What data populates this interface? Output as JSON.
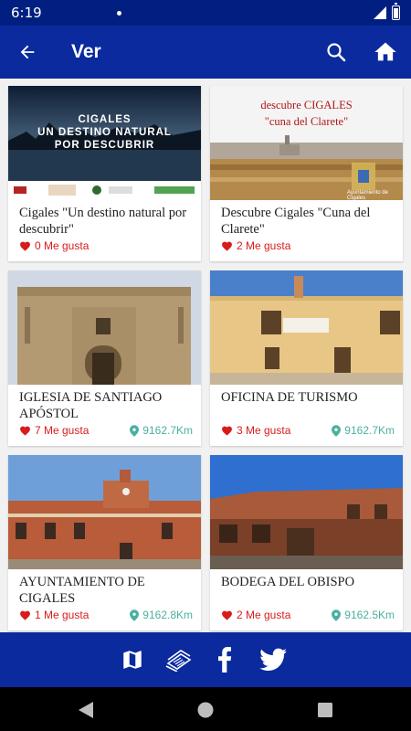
{
  "status": {
    "time": "6:19"
  },
  "app_bar": {
    "title": "Ver"
  },
  "cards": [
    {
      "name": "Cigales \"Un destino natural por descubrir\"",
      "likes": "0 Me gusta",
      "distance": "",
      "image_text": "CIGALES\nUN DESTINO NATURAL\nPOR DESCUBRIR"
    },
    {
      "name": "Descubre Cigales \"Cuna del Clarete\"",
      "likes": "2 Me gusta",
      "distance": "",
      "image_text_1": "descubre CIGALES",
      "image_text_2": "\"cuna del Clarete\"",
      "image_caption": "Ayuntamiento de Cigales"
    },
    {
      "name": "IGLESIA DE SANTIAGO APÓSTOL",
      "likes": "7 Me gusta",
      "distance": "9162.7Km"
    },
    {
      "name": "OFICINA DE TURISMO",
      "likes": "3 Me gusta",
      "distance": "9162.7Km"
    },
    {
      "name": "AYUNTAMIENTO DE CIGALES",
      "likes": "1 Me gusta",
      "distance": "9162.8Km"
    },
    {
      "name": "BODEGA DEL OBISPO",
      "likes": "2 Me gusta",
      "distance": "9162.5Km"
    }
  ],
  "colors": {
    "primary": "#0a2a9e",
    "status": "#001f80",
    "like": "#d81b1b",
    "distance": "#4bb0a0"
  }
}
